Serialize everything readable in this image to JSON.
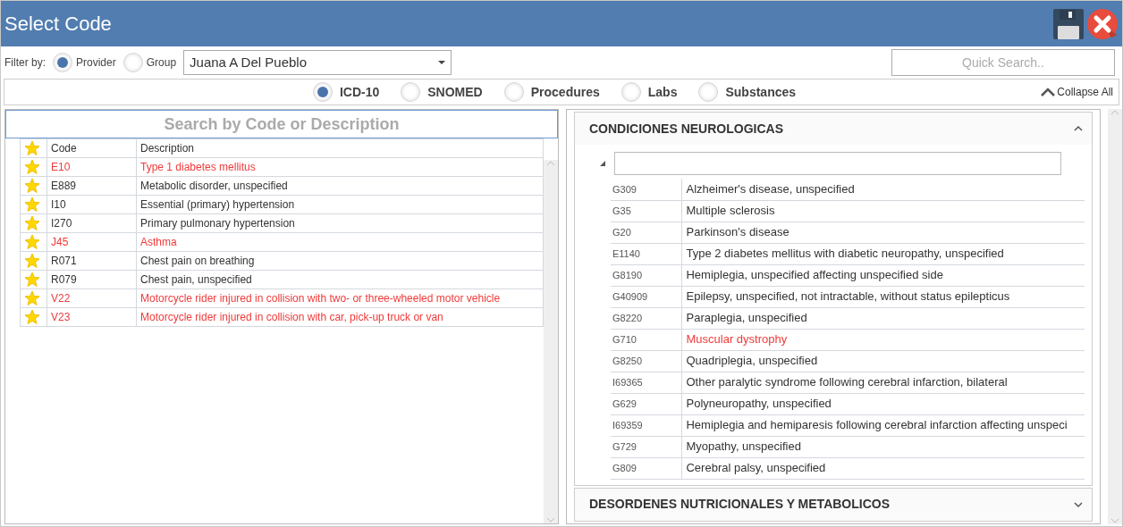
{
  "window": {
    "title": "Select Code"
  },
  "filter": {
    "label": "Filter by:",
    "options": [
      {
        "label": "Provider",
        "selected": true
      },
      {
        "label": "Group",
        "selected": false
      }
    ],
    "provider": "Juana A Del Pueblo"
  },
  "quick_search": {
    "placeholder": "Quick Search.."
  },
  "code_types": [
    {
      "label": "ICD-10",
      "selected": true
    },
    {
      "label": "SNOMED",
      "selected": false
    },
    {
      "label": "Procedures",
      "selected": false
    },
    {
      "label": "Labs",
      "selected": false
    },
    {
      "label": "Substances",
      "selected": false
    }
  ],
  "collapse_all": "Collapse All",
  "favorites": {
    "search_placeholder": "Search by Code or Description",
    "columns": [
      "Code",
      "Description"
    ],
    "rows": [
      {
        "code": "E10",
        "description": "Type 1 diabetes mellitus",
        "starred": true,
        "highlighted": true
      },
      {
        "code": "E889",
        "description": "Metabolic disorder, unspecified",
        "starred": true,
        "highlighted": false
      },
      {
        "code": "I10",
        "description": "Essential (primary) hypertension",
        "starred": true,
        "highlighted": false
      },
      {
        "code": "I270",
        "description": "Primary pulmonary hypertension",
        "starred": true,
        "highlighted": false
      },
      {
        "code": "J45",
        "description": "Asthma",
        "starred": true,
        "highlighted": true
      },
      {
        "code": "R071",
        "description": "Chest pain on breathing",
        "starred": true,
        "highlighted": false
      },
      {
        "code": "R079",
        "description": "Chest pain, unspecified",
        "starred": true,
        "highlighted": false
      },
      {
        "code": "V22",
        "description": "Motorcycle rider injured in collision with two- or three-wheeled motor vehicle",
        "starred": true,
        "highlighted": true
      },
      {
        "code": "V23",
        "description": "Motorcycle rider injured in collision with car, pick-up truck or van",
        "starred": true,
        "highlighted": true
      }
    ]
  },
  "groups": [
    {
      "title": "CONDICIONES NEUROLOGICAS",
      "expanded": true,
      "rows": [
        {
          "code": "G309",
          "description": "Alzheimer's disease, unspecified",
          "highlighted": false
        },
        {
          "code": "G35",
          "description": "Multiple sclerosis",
          "highlighted": false
        },
        {
          "code": "G20",
          "description": "Parkinson's disease",
          "highlighted": false
        },
        {
          "code": "E1140",
          "description": "Type 2 diabetes mellitus with diabetic neuropathy, unspecified",
          "highlighted": false
        },
        {
          "code": "G8190",
          "description": "Hemiplegia, unspecified affecting unspecified side",
          "highlighted": false
        },
        {
          "code": "G40909",
          "description": "Epilepsy, unspecified, not intractable, without status epilepticus",
          "highlighted": false
        },
        {
          "code": "G8220",
          "description": "Paraplegia, unspecified",
          "highlighted": false
        },
        {
          "code": "G710",
          "description": "Muscular dystrophy",
          "highlighted": true
        },
        {
          "code": "G8250",
          "description": "Quadriplegia, unspecified",
          "highlighted": false
        },
        {
          "code": "I69365",
          "description": "Other paralytic syndrome following cerebral infarction, bilateral",
          "highlighted": false
        },
        {
          "code": "G629",
          "description": "Polyneuropathy, unspecified",
          "highlighted": false
        },
        {
          "code": "I69359",
          "description": "Hemiplegia and hemiparesis following cerebral infarction affecting unspeci",
          "highlighted": false
        },
        {
          "code": "G729",
          "description": "Myopathy, unspecified",
          "highlighted": false
        },
        {
          "code": "G809",
          "description": "Cerebral palsy, unspecified",
          "highlighted": false
        }
      ]
    },
    {
      "title": "DESORDENES NUTRICIONALES Y METABOLICOS",
      "expanded": false
    }
  ]
}
